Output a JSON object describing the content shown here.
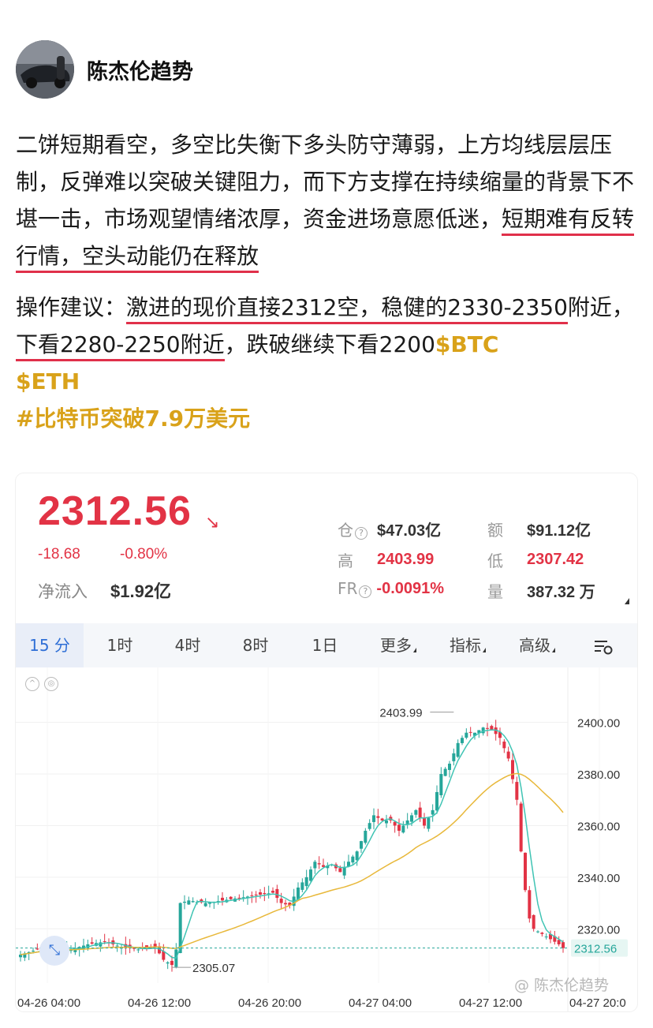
{
  "author": {
    "name": "陈杰伦趋势"
  },
  "post": {
    "p1_part1": "二饼短期看空，多空比失衡下多头防守薄弱，上方均线层层压制，反弹难以突破关键阻力，而下方支撑在持续缩量的背景下不堪一击，市场观望情绪浓厚，资金进场意愿低迷，",
    "p1_underlined": "短期难有反转行情，空头动能仍在释放",
    "p2_prefix": "操作建议：",
    "p2_underlined1": "激进的现价直接2312空，稳健的2330-2350",
    "p2_mid": "附近，",
    "p2_underlined2": "下看2280-2250附近",
    "p2_suffix": "，跌破继续下看2200",
    "tag_btc": "$BTC",
    "tag_eth": "$ETH",
    "hashtag": "#比特币突破7.9万美元"
  },
  "market": {
    "price": "2312.56",
    "arrow": "↘",
    "change_abs": "-18.68",
    "change_pct": "-0.80%",
    "netflow_label": "净流入",
    "netflow_value": "$1.92亿",
    "stats": {
      "oi_label": "仓",
      "oi_value": "$47.03亿",
      "amount_label": "额",
      "amount_value": "$91.12亿",
      "high_label": "高",
      "high_value": "2403.99",
      "low_label": "低",
      "low_value": "2307.42",
      "fr_label": "FR",
      "fr_value": "-0.0091%",
      "vol_label": "量",
      "vol_value": "387.32 万"
    },
    "tabs": [
      "15 分",
      "1时",
      "4时",
      "8时",
      "1日",
      "更多",
      "指标",
      "高级"
    ],
    "watermark": "@ 陈杰伦趋势",
    "colors": {
      "up": "#26a69a",
      "down": "#e23345",
      "ma_fast": "#40c4b4",
      "ma_slow": "#e8b83a",
      "accent": "#2f6fd6"
    }
  },
  "chart_data": {
    "type": "candlestick",
    "x_tick_labels": [
      "04-26 04:00",
      "04-26 12:00",
      "04-26 20:00",
      "04-27 04:00",
      "04-27 12:00",
      "04-27 20:0"
    ],
    "y_tick_labels": [
      "2400.00",
      "2380.00",
      "2360.00",
      "2340.00",
      "2320.00"
    ],
    "ylim": [
      2299,
      2406
    ],
    "last_price_label": "2312.56",
    "high_label": "2403.99",
    "low_label": "2305.07",
    "close_path": [
      [
        0,
        2310
      ],
      [
        4,
        2312
      ],
      [
        8,
        2313
      ],
      [
        12,
        2312
      ],
      [
        16,
        2314
      ],
      [
        20,
        2315
      ],
      [
        24,
        2313
      ],
      [
        28,
        2312
      ],
      [
        32,
        2313
      ],
      [
        34,
        2308
      ],
      [
        36,
        2306
      ],
      [
        37,
        2312
      ],
      [
        38,
        2330
      ],
      [
        40,
        2331
      ],
      [
        44,
        2330
      ],
      [
        48,
        2331
      ],
      [
        52,
        2332
      ],
      [
        56,
        2333
      ],
      [
        60,
        2334
      ],
      [
        62,
        2330
      ],
      [
        64,
        2329
      ],
      [
        66,
        2336
      ],
      [
        68,
        2340
      ],
      [
        70,
        2346
      ],
      [
        72,
        2344
      ],
      [
        74,
        2345
      ],
      [
        76,
        2342
      ],
      [
        78,
        2346
      ],
      [
        80,
        2350
      ],
      [
        82,
        2358
      ],
      [
        84,
        2364
      ],
      [
        86,
        2362
      ],
      [
        88,
        2362
      ],
      [
        90,
        2358
      ],
      [
        92,
        2362
      ],
      [
        94,
        2366
      ],
      [
        96,
        2360
      ],
      [
        98,
        2366
      ],
      [
        100,
        2380
      ],
      [
        102,
        2384
      ],
      [
        104,
        2392
      ],
      [
        106,
        2396
      ],
      [
        108,
        2396
      ],
      [
        110,
        2398
      ],
      [
        112,
        2397
      ],
      [
        114,
        2394
      ],
      [
        116,
        2386
      ],
      [
        118,
        2370
      ],
      [
        119,
        2350
      ],
      [
        120,
        2335
      ],
      [
        121,
        2324
      ],
      [
        122,
        2320
      ],
      [
        124,
        2318
      ],
      [
        126,
        2316
      ],
      [
        128,
        2314
      ],
      [
        129,
        2312.56
      ]
    ]
  }
}
